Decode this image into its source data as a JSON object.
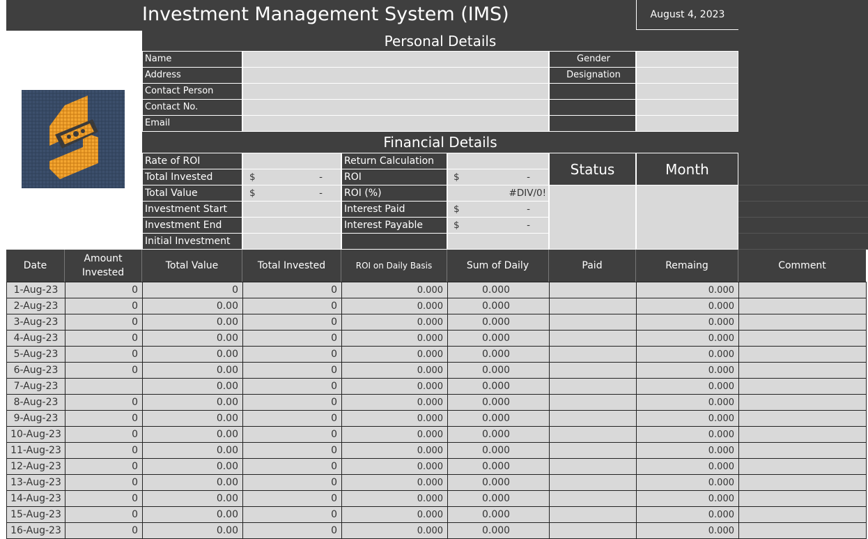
{
  "header": {
    "title": "Investment Management System (IMS)",
    "date": "August 4, 2023"
  },
  "logo": {
    "icon": "ims-logo-icon"
  },
  "personal": {
    "section_title": "Personal Details",
    "labels": [
      "Name",
      "Address",
      "Contact Person",
      "Contact No.",
      "Email"
    ],
    "right_labels": [
      "Gender",
      "Designation"
    ]
  },
  "financial": {
    "section_title": "Financial Details",
    "left_labels": [
      "Rate of ROI",
      "Total Invested",
      "Total Value",
      "Investment Start",
      "Investment End",
      "Initial Investment"
    ],
    "left_values": [
      {
        "cur": "",
        "val": ""
      },
      {
        "cur": "$",
        "val": "-"
      },
      {
        "cur": "$",
        "val": "-"
      },
      {
        "cur": "",
        "val": ""
      },
      {
        "cur": "",
        "val": ""
      },
      {
        "cur": "",
        "val": ""
      }
    ],
    "mid_labels": [
      "Return Calculation",
      "ROI",
      "ROI (%)",
      "Interest Paid",
      "Interest Payable",
      ""
    ],
    "mid_values": [
      {
        "cur": "",
        "val": ""
      },
      {
        "cur": "$",
        "val": "-"
      },
      {
        "cur": "",
        "val": "#DIV/0!"
      },
      {
        "cur": "$",
        "val": "-"
      },
      {
        "cur": "$",
        "val": "-"
      },
      {
        "cur": "",
        "val": ""
      }
    ],
    "status_label": "Status",
    "month_label": "Month"
  },
  "table": {
    "columns": [
      "Date",
      "Amount Invested",
      "Total Value",
      "Total Invested",
      "ROI on Daily Basis",
      "Sum of Daily",
      "Paid",
      "Remaing",
      "Comment"
    ],
    "rows": [
      [
        "1-Aug-23",
        "0",
        "0",
        "0",
        "0.000",
        "0.000",
        "",
        "0.000",
        ""
      ],
      [
        "2-Aug-23",
        "0",
        "0.00",
        "0",
        "0.000",
        "0.000",
        "",
        "0.000",
        ""
      ],
      [
        "3-Aug-23",
        "0",
        "0.00",
        "0",
        "0.000",
        "0.000",
        "",
        "0.000",
        ""
      ],
      [
        "4-Aug-23",
        "0",
        "0.00",
        "0",
        "0.000",
        "0.000",
        "",
        "0.000",
        ""
      ],
      [
        "5-Aug-23",
        "0",
        "0.00",
        "0",
        "0.000",
        "0.000",
        "",
        "0.000",
        ""
      ],
      [
        "6-Aug-23",
        "0",
        "0.00",
        "0",
        "0.000",
        "0.000",
        "",
        "0.000",
        ""
      ],
      [
        "7-Aug-23",
        "",
        "0.00",
        "0",
        "0.000",
        "0.000",
        "",
        "0.000",
        ""
      ],
      [
        "8-Aug-23",
        "0",
        "0.00",
        "0",
        "0.000",
        "0.000",
        "",
        "0.000",
        ""
      ],
      [
        "9-Aug-23",
        "0",
        "0.00",
        "0",
        "0.000",
        "0.000",
        "",
        "0.000",
        ""
      ],
      [
        "10-Aug-23",
        "0",
        "0.00",
        "0",
        "0.000",
        "0.000",
        "",
        "0.000",
        ""
      ],
      [
        "11-Aug-23",
        "0",
        "0.00",
        "0",
        "0.000",
        "0.000",
        "",
        "0.000",
        ""
      ],
      [
        "12-Aug-23",
        "0",
        "0.00",
        "0",
        "0.000",
        "0.000",
        "",
        "0.000",
        ""
      ],
      [
        "13-Aug-23",
        "0",
        "0.00",
        "0",
        "0.000",
        "0.000",
        "",
        "0.000",
        ""
      ],
      [
        "14-Aug-23",
        "0",
        "0.00",
        "0",
        "0.000",
        "0.000",
        "",
        "0.000",
        ""
      ],
      [
        "15-Aug-23",
        "0",
        "0.00",
        "0",
        "0.000",
        "0.000",
        "",
        "0.000",
        ""
      ],
      [
        "16-Aug-23",
        "0",
        "0.00",
        "0",
        "0.000",
        "0.000",
        "",
        "0.000",
        ""
      ]
    ]
  },
  "colors": {
    "dark": "#3f3f3f",
    "light": "#d9d9d9",
    "logo_orange": "#f2a230",
    "logo_bg": "#2e3f57"
  }
}
